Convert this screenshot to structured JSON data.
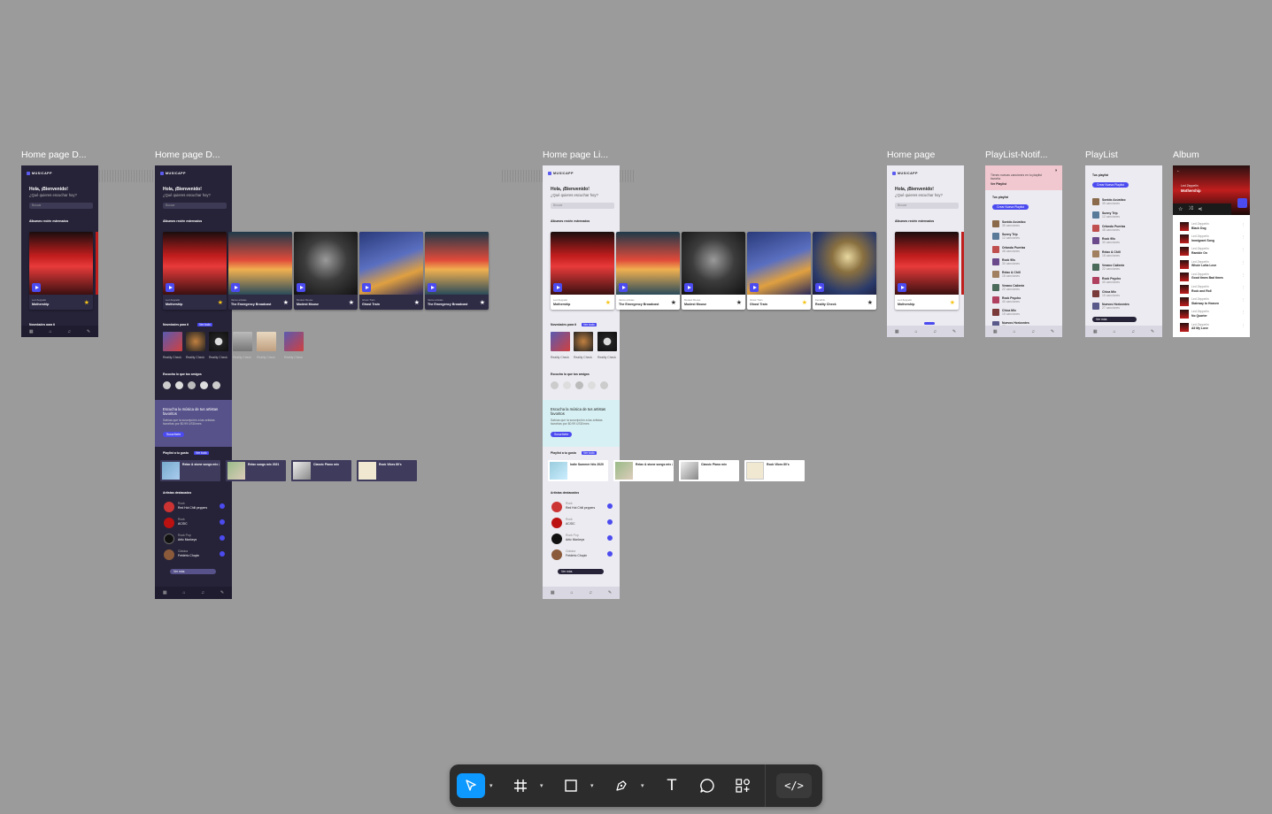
{
  "frames": {
    "f1": {
      "label": "Home page D..."
    },
    "f2": {
      "label": "Home page D..."
    },
    "f3": {
      "label": "Home page Li..."
    },
    "f4": {
      "label": "Home page"
    },
    "f5": {
      "label": "PlayList-Notif..."
    },
    "f6": {
      "label": "PlayList"
    },
    "f7": {
      "label": "Album"
    }
  },
  "app": {
    "logo": "MUSICAPP",
    "greeting": "Hola, ¡Bienvenido!",
    "question": "¿Qué quieres escuchar hoy?",
    "search_placeholder": "Buscar",
    "section_albums": "Álbumes recién estrenados",
    "section_news": "Novedades para ti",
    "section_friends": "Escucha lo que tus amigos",
    "promo_title": "Escucha la música de tus artistas favoritos",
    "promo_text": "Sabías que la suscripción a las artistas favoritas por $0.99 USD/mes",
    "promo_button": "Suscríbete",
    "section_playlists": "Playlist a tu gusto",
    "section_artists": "Artistas destacados",
    "more_button": "Ver más",
    "badge": "Ver todo"
  },
  "albums": [
    {
      "artist": "Led Zeppelin",
      "title": "Mothership",
      "starred": true
    },
    {
      "artist": "Varios artistas",
      "title": "The Emergency Broadcast",
      "starred": false
    },
    {
      "artist": "Modest Mouse",
      "title": "Modest Mouse",
      "starred": false
    },
    {
      "artist": "Ghost Train",
      "title": "Ghost Train",
      "starred": false
    },
    {
      "artist": "Varios artistas",
      "title": "The Emergency Broadcast",
      "starred": false
    }
  ],
  "albums_light": [
    {
      "artist": "Led Zeppelin",
      "title": "Mothership"
    },
    {
      "artist": "Varios artistas",
      "title": "The Emergency Broadcast"
    },
    {
      "artist": "Modest Mouse",
      "title": "Modest Mouse"
    },
    {
      "artist": "Ghost Train",
      "title": "Ghost Train"
    },
    {
      "artist": "Kendrick",
      "title": "Reality Check"
    }
  ],
  "news": [
    {
      "title": "Reality Check"
    },
    {
      "title": "Reality Check"
    },
    {
      "title": "Reality Check"
    },
    {
      "title": "Reality Check"
    },
    {
      "title": "Reality Check"
    },
    {
      "title": "Reality Check"
    }
  ],
  "playlists": [
    {
      "title": "Relax & stone songs mix 2021"
    },
    {
      "title": "Relax songs mix 2021"
    },
    {
      "title": "Classic Piano mix"
    },
    {
      "title": "Rock Vibes 80's"
    }
  ],
  "playlists_light": [
    {
      "title": "Indie Summer hits 2020"
    },
    {
      "title": "Relax & stone songs mix 2021"
    },
    {
      "title": "Classic Piano mix"
    },
    {
      "title": "Rock Vibes 80's"
    }
  ],
  "artists": [
    {
      "genre": "Rock",
      "name": "Red Hot Chili peppers"
    },
    {
      "genre": "Rock",
      "name": "AC/DC"
    },
    {
      "genre": "Rock Pop",
      "name": "Artic Monkeys"
    },
    {
      "genre": "Clásica",
      "name": "Frédéric Chopin"
    }
  ],
  "notif": {
    "text": "Tienes nuevas canciones en tu playlist favorita",
    "link": "Ver Playlist",
    "close": "×"
  },
  "playlist_page": {
    "heading": "Tus playlist",
    "new_button": "Crear Nueva Playlist",
    "items": [
      {
        "name": "Sonido Acústico",
        "count": "35 canciones"
      },
      {
        "name": "Sunny Trip",
        "count": "12 canciones"
      },
      {
        "name": "Orlando Puertas",
        "count": "48 canciones"
      },
      {
        "name": "Rock 90s",
        "count": "30 canciones"
      },
      {
        "name": "Relax & Chill",
        "count": "18 canciones"
      },
      {
        "name": "Verano Caliente",
        "count": "22 canciones"
      },
      {
        "name": "Rock Psycho",
        "count": "40 canciones"
      },
      {
        "name": "Chica Mix",
        "count": "15 canciones"
      },
      {
        "name": "Nuevos Horizontes",
        "count": "27 canciones"
      }
    ]
  },
  "album_page": {
    "artist": "Led Zeppelin",
    "title": "Mothership",
    "tracks": [
      {
        "artist": "Led Zeppelin",
        "title": "Black Dog"
      },
      {
        "artist": "Led Zeppelin",
        "title": "Immigrant Song"
      },
      {
        "artist": "Led Zeppelin",
        "title": "Ramble On"
      },
      {
        "artist": "Led Zeppelin",
        "title": "Whole Lotta Love"
      },
      {
        "artist": "Led Zeppelin",
        "title": "Good times Bad times"
      },
      {
        "artist": "Led Zeppelin",
        "title": "Rock and Roll"
      },
      {
        "artist": "Led Zeppelin",
        "title": "Stairway to Heaven"
      },
      {
        "artist": "Led Zeppelin",
        "title": "No Quarter"
      },
      {
        "artist": "Led Zeppelin",
        "title": "All My Love"
      }
    ]
  },
  "toolbar": {
    "move": "move-tool",
    "frame": "frame-tool",
    "shape": "rectangle-tool",
    "pen": "pen-tool",
    "text": "T",
    "comment": "comment-tool",
    "actions": "actions-tool",
    "dev": "</>"
  }
}
